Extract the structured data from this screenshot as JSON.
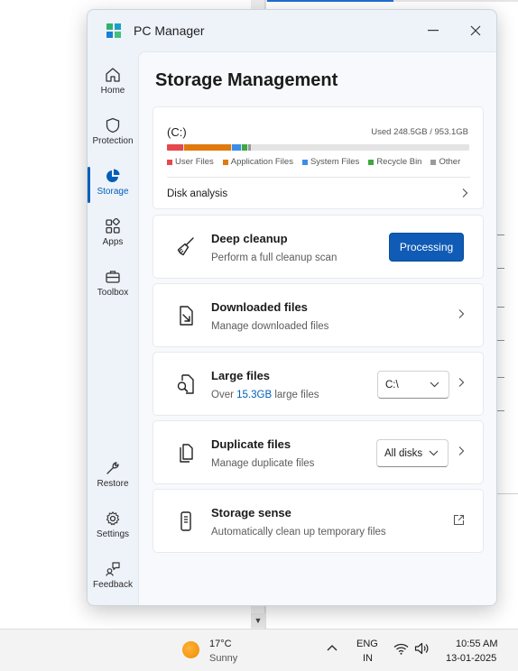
{
  "app": {
    "title": "PC Manager"
  },
  "colors": {
    "accent": "#005fb8",
    "button": "#0f5bb5"
  },
  "nav": {
    "items": [
      {
        "label": "Home",
        "icon": "home-icon"
      },
      {
        "label": "Protection",
        "icon": "shield-icon"
      },
      {
        "label": "Storage",
        "icon": "pie-chart-icon",
        "active": true
      },
      {
        "label": "Apps",
        "icon": "apps-grid-icon"
      },
      {
        "label": "Toolbox",
        "icon": "toolbox-icon"
      },
      {
        "label": "Restore",
        "icon": "wrench-icon"
      },
      {
        "label": "Settings",
        "icon": "gear-icon"
      },
      {
        "label": "Feedback",
        "icon": "feedback-icon"
      }
    ]
  },
  "page": {
    "title": "Storage Management"
  },
  "disk": {
    "drive": "(C:)",
    "used_text": "Used 248.5GB / 953.1GB",
    "segments": [
      {
        "name": "User Files",
        "color": "#e5484d",
        "fraction": 0.055
      },
      {
        "name": "Application Files",
        "color": "#e07a0f",
        "fraction": 0.155
      },
      {
        "name": "System Files",
        "color": "#3b8ee8",
        "fraction": 0.03
      },
      {
        "name": "Recycle Bin",
        "color": "#3ea83e",
        "fraction": 0.017
      },
      {
        "name": "Other",
        "color": "#9a9a9a",
        "fraction": 0.008
      }
    ],
    "legend": [
      "User Files",
      "Application Files",
      "System Files",
      "Recycle Bin",
      "Other"
    ],
    "analysis_label": "Disk analysis"
  },
  "features": {
    "deep_cleanup": {
      "title": "Deep cleanup",
      "subtitle": "Perform a full cleanup scan",
      "button": "Processing"
    },
    "downloaded": {
      "title": "Downloaded files",
      "subtitle": "Manage downloaded files"
    },
    "large": {
      "title": "Large files",
      "subtitle_prefix": "Over ",
      "size": "15.3GB",
      "subtitle_suffix": " large files",
      "select_value": "C:\\"
    },
    "duplicate": {
      "title": "Duplicate files",
      "subtitle": "Manage duplicate files",
      "select_value": "All disks"
    },
    "storage_sense": {
      "title": "Storage sense",
      "subtitle": "Automatically clean up temporary files"
    }
  },
  "taskbar": {
    "weather_temp": "17°C",
    "weather_cond": "Sunny",
    "lang_line1": "ENG",
    "lang_line2": "IN",
    "time": "10:55 AM",
    "date": "13-01-2025"
  }
}
